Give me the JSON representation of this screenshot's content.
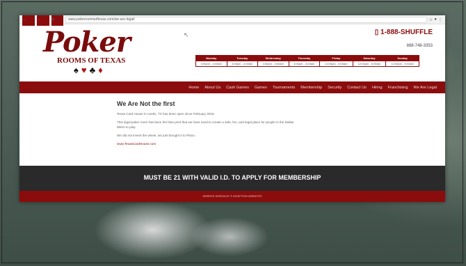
{
  "browser": {
    "url": "www.pokerroomsoftexas.com/we-are-legal/"
  },
  "logo": {
    "script": "Poker",
    "sub": "ROOMS OF TEXAS",
    "suits": [
      "♠",
      "♥",
      "♣",
      "♦"
    ]
  },
  "contact": {
    "phone_main": "1-888-SHUFFLE",
    "phone_alt": "888-748-3353"
  },
  "hours": [
    {
      "day": "Monday",
      "time": "3:00pm - 4:00am"
    },
    {
      "day": "Tuesday",
      "time": "3:00pm - 4:00am"
    },
    {
      "day": "Wednesday",
      "time": "3:00pm - 4:00am"
    },
    {
      "day": "Thursday",
      "time": "3:00pm - 4:00am"
    },
    {
      "day": "Friday",
      "time": "12:00pm - 5:00am"
    },
    {
      "day": "Saturday",
      "time": "12:00pm - 5:00am"
    },
    {
      "day": "Sunday",
      "time": "12:00pm - 5:00am"
    }
  ],
  "nav": [
    "Home",
    "About Us",
    "Cash Games",
    "Games",
    "Tournaments",
    "Membership",
    "Security",
    "Contact Us",
    "Hiring",
    "Franchising",
    "We Are Legal"
  ],
  "content": {
    "title": "We Are Not the first",
    "p1": "Texas Card House in Austin, TX has been open since February 2015.",
    "p2": "This legal poker room has been the blue print that we have used to create a safe, fun, and legal place for people in the Dallas Metro to play.",
    "p3": "We did not invent the wheel, we just brought it to Plano.",
    "link": "www.TexasCardHouse.com"
  },
  "banner": "MUST BE 21 WITH VALID I.D. TO APPLY FOR MEMBERSHIP",
  "footer": "WEBSITE DESIGN BY ©  INCEPTION WEBSITES",
  "colors": {
    "brand": "#8b0c0c",
    "banner": "#2a2a2a"
  }
}
